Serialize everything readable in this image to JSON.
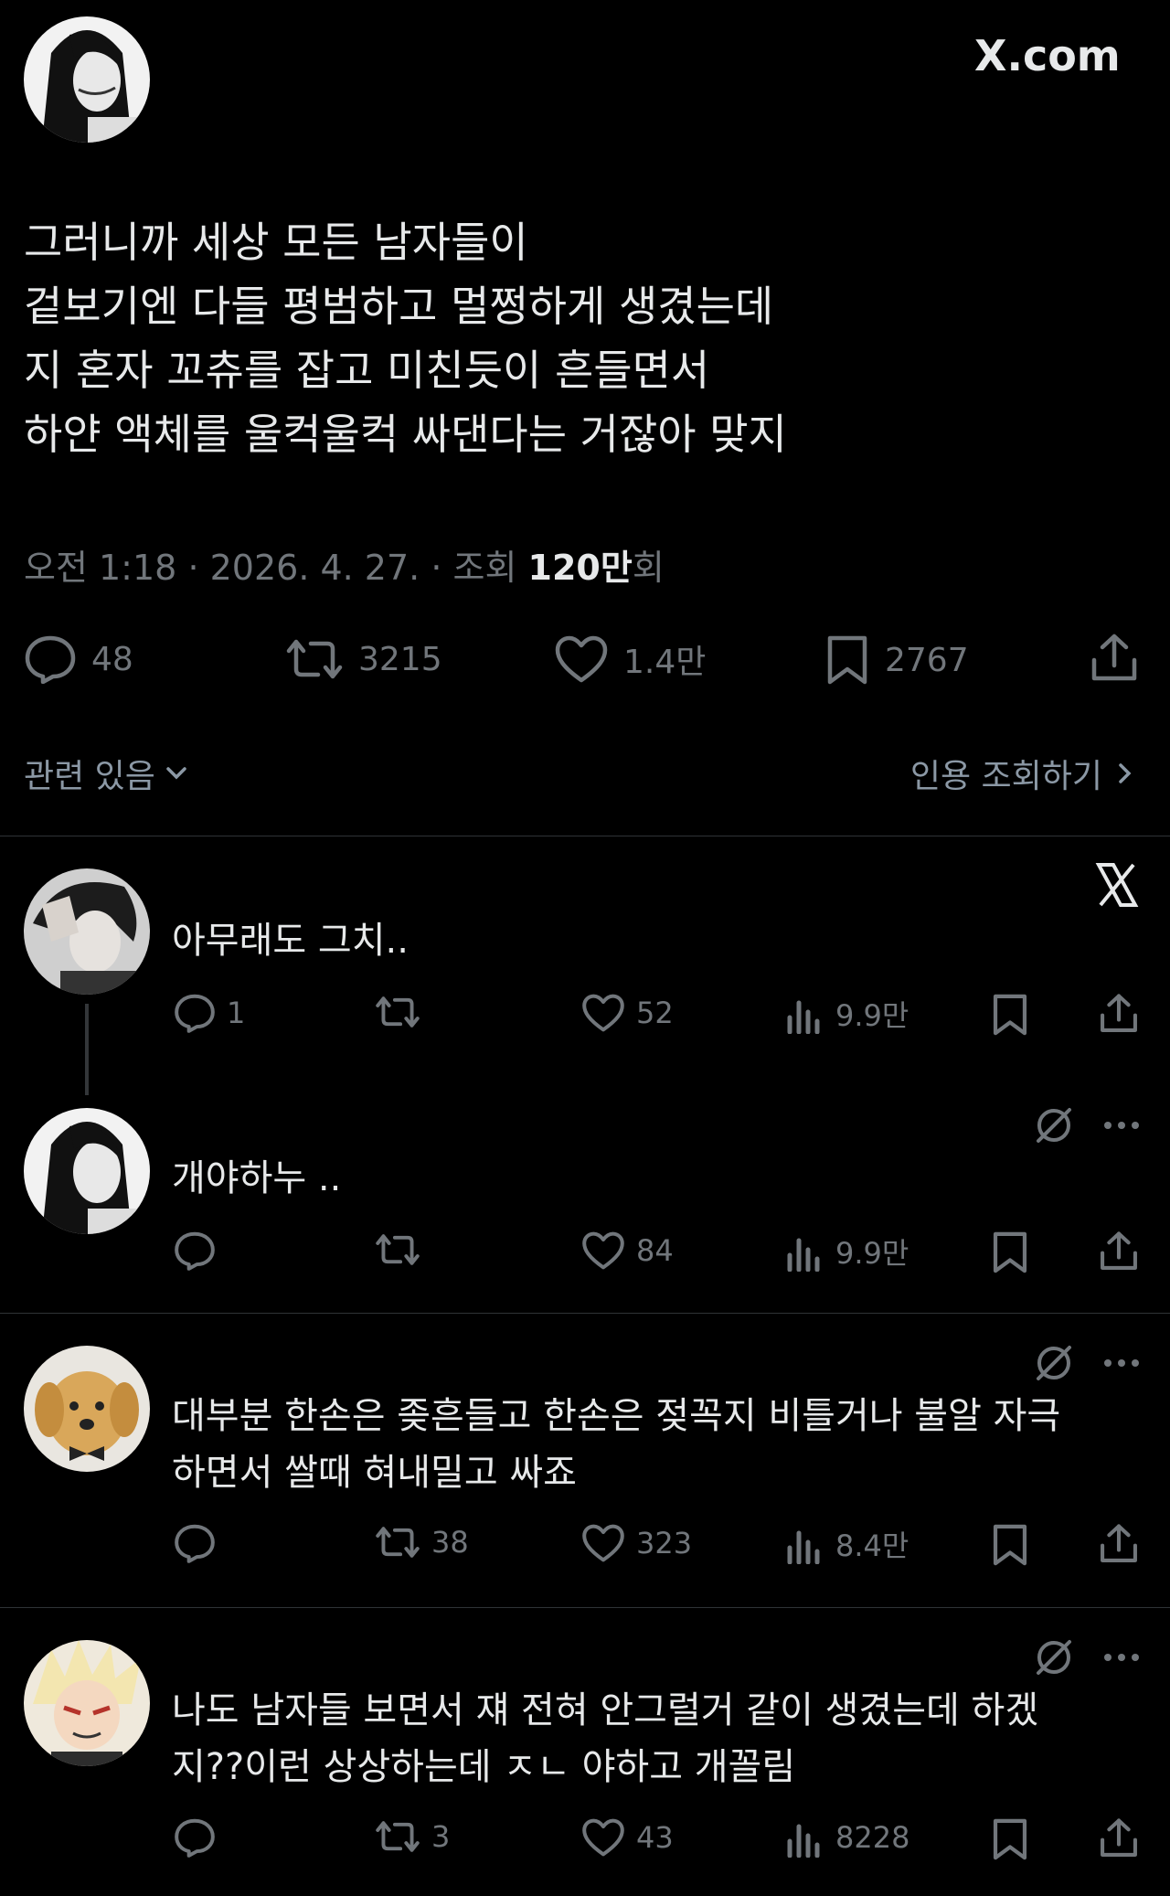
{
  "brand": {
    "site": "X.com"
  },
  "main_post": {
    "text": "그러니까 세상 모든 남자들이\n겉보기엔 다들 평범하고 멀쩡하게 생겼는데\n지 혼자 꼬츄를 잡고 미친듯이 흔들면서\n하얀 액체를 울컥울컥 싸댄다는 거잖아 맞지",
    "time": "오전 1:18",
    "date": "2026. 4. 27.",
    "views_prefix": "조회",
    "views_value": "120만",
    "views_suffix": "회",
    "replies": "48",
    "reposts": "3215",
    "likes": "1.4만",
    "bookmarks": "2767"
  },
  "related": {
    "label": "관련 있음",
    "quote_label": "인용 조회하기"
  },
  "replies": [
    {
      "text": "아무래도 그치..",
      "replies": "1",
      "reposts": "",
      "likes": "52",
      "views": "9.9만"
    },
    {
      "text": "개야하누 ..",
      "replies": "",
      "reposts": "",
      "likes": "84",
      "views": "9.9만"
    },
    {
      "text": "대부분 한손은 좆흔들고 한손은 젖꼭지 비틀거나 불알 자극\n하면서 쌀때 혀내밀고 싸죠",
      "replies": "",
      "reposts": "38",
      "likes": "323",
      "views": "8.4만"
    },
    {
      "text": "나도 남자들 보면서 쟤 전혀 안그럴거 같이 생겼는데 하겠\n지??이런 상상하는데 ㅈㄴ 야하고 개꼴림",
      "replies": "",
      "reposts": "3",
      "likes": "43",
      "views": "8228"
    }
  ],
  "colors": {
    "background": "#000000",
    "text": "#e7e9ea",
    "muted": "#71767b",
    "divider": "#2f3336"
  }
}
